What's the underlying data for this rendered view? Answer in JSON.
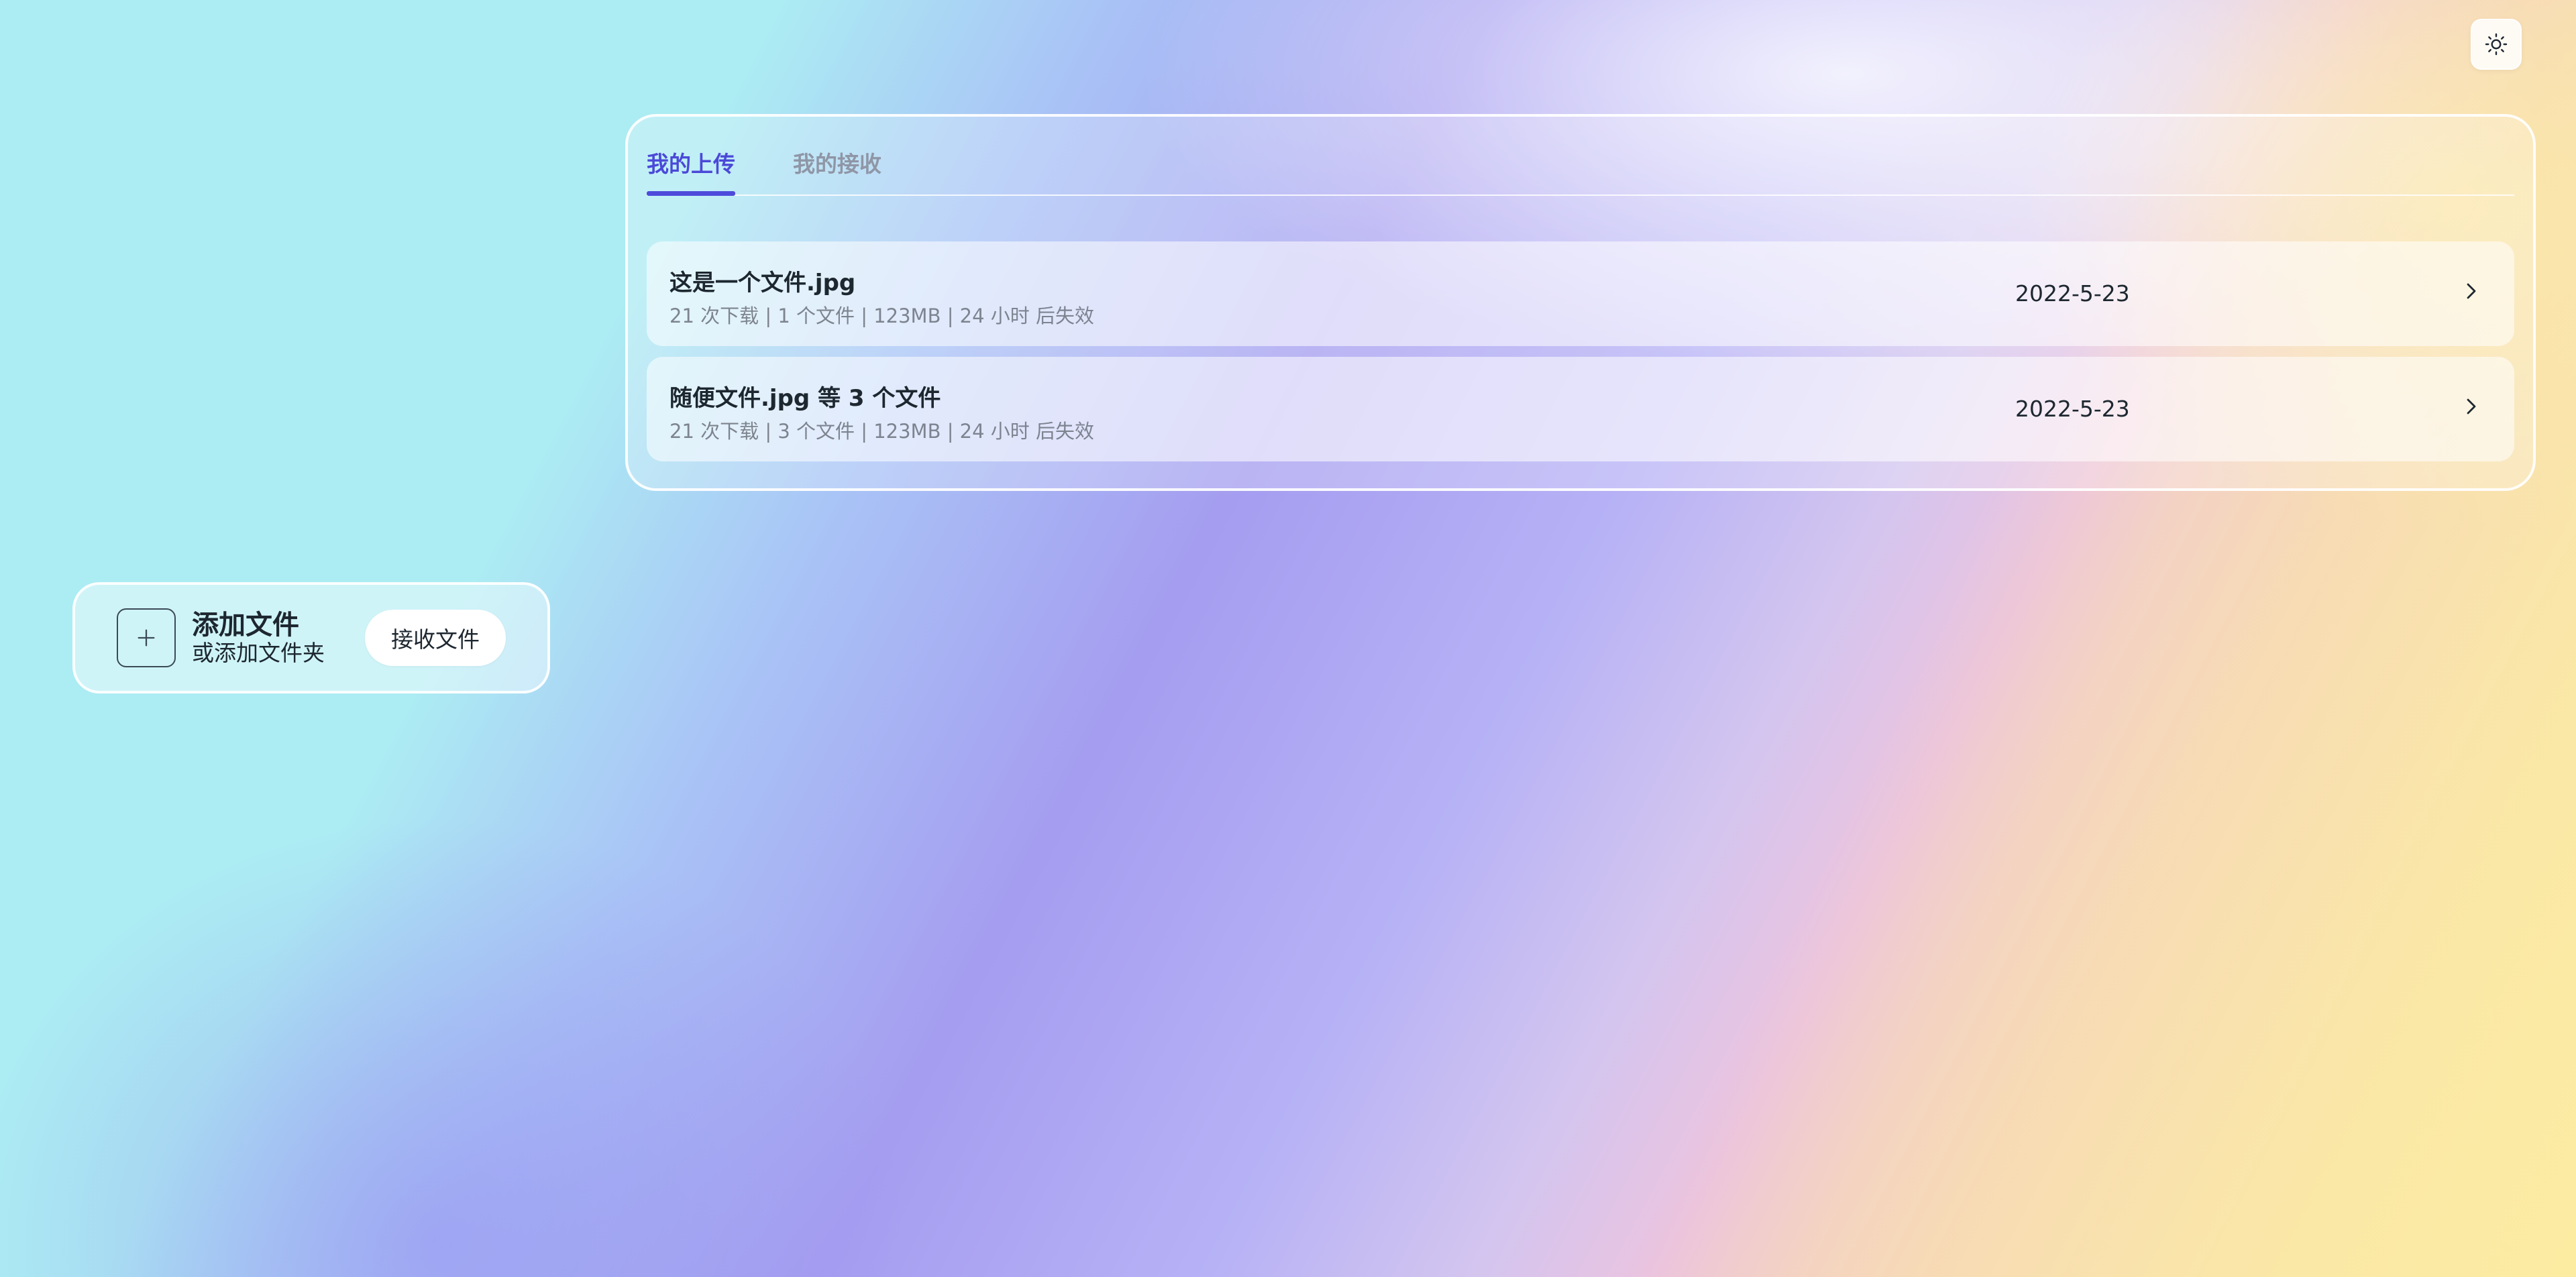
{
  "theme_toggle": {
    "icon": "sun-icon"
  },
  "add_card": {
    "plus_icon": "plus-icon",
    "title": "添加文件",
    "subtitle": "或添加文件夹",
    "receive_button": "接收文件"
  },
  "tabs": [
    {
      "label": "我的上传",
      "active": true
    },
    {
      "label": "我的接收",
      "active": false
    }
  ],
  "files": [
    {
      "name": "这是一个文件.jpg",
      "meta": "21 次下载 | 1 个文件 | 123MB | 24 小时 后失效",
      "date": "2022-5-23"
    },
    {
      "name": "随便文件.jpg 等 3 个文件",
      "meta": "21 次下载 | 3 个文件 | 123MB | 24 小时 后失效",
      "date": "2022-5-23"
    }
  ],
  "colors": {
    "accent": "#4e4bdc",
    "text": "#1d2730",
    "muted": "#7d8490"
  }
}
